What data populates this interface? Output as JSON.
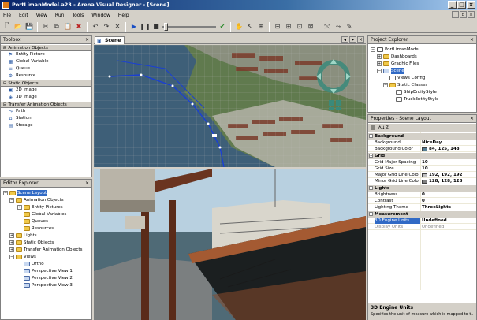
{
  "window": {
    "title": "PortLimanModel.a23 - Arena Visual Designer - [Scene]"
  },
  "menu": [
    "File",
    "Edit",
    "View",
    "Run",
    "Tools",
    "Window",
    "Help"
  ],
  "toolbox": {
    "title": "Toolbox",
    "categories": [
      {
        "label": "Animation Objects",
        "items": [
          "Entity Picture",
          "Global Variable",
          "Queue",
          "Resource"
        ]
      },
      {
        "label": "Static Objects",
        "items": [
          "2D Image",
          "3D Image"
        ]
      },
      {
        "label": "Transfer Animation Objects",
        "items": [
          "Path",
          "Station",
          "Storage"
        ]
      }
    ]
  },
  "editor_explorer": {
    "title": "Editor Explorer",
    "rows": [
      "Scene Layout",
      "Animation Objects",
      "Entity Pictures",
      "Global Variables",
      "Queues",
      "Resources",
      "Lights",
      "Static Objects",
      "Transfer Animation Objects",
      "Views",
      "Ortho",
      "Perspective View 1",
      "Perspective View 2",
      "Perspective View 3"
    ]
  },
  "scene_tab": {
    "label": "Scene"
  },
  "project_explorer": {
    "title": "Project Explorer",
    "rows": [
      "PortLimanModel",
      "Dashboards",
      "Graphic Files",
      "Scene",
      "Views Config",
      "Static Classes",
      "ShipEntityStyle",
      "TruckEntityStyle"
    ]
  },
  "properties": {
    "title": "Properties - Scene Layout",
    "groups": [
      {
        "label": "Background",
        "rows": [
          {
            "name": "Background",
            "value": "NiceDay"
          },
          {
            "name": "Background Color",
            "value": "84, 125, 148",
            "color": "#547d94"
          }
        ]
      },
      {
        "label": "Grid",
        "rows": [
          {
            "name": "Grid Major Spacing",
            "value": "10"
          },
          {
            "name": "Grid Size",
            "value": "10"
          },
          {
            "name": "Major Grid Line Colo",
            "value": "192, 192, 192",
            "color": "#c0c0c0"
          },
          {
            "name": "Minor Grid Line Colo",
            "value": "128, 128, 128",
            "color": "#808080"
          }
        ]
      },
      {
        "label": "Lights",
        "rows": [
          {
            "name": "Brightness",
            "value": "0"
          },
          {
            "name": "Contrast",
            "value": "0"
          },
          {
            "name": "Lighting Theme",
            "value": "ThreeLights"
          }
        ]
      },
      {
        "label": "Measurement",
        "rows": [
          {
            "name": "3D Engine Units",
            "value": "Undefined"
          },
          {
            "name": "Display Units",
            "value": "Undefined"
          }
        ]
      }
    ],
    "description": {
      "title": "3D Engine Units",
      "text": "Specifies the unit of measure which is mapped to t..."
    }
  }
}
